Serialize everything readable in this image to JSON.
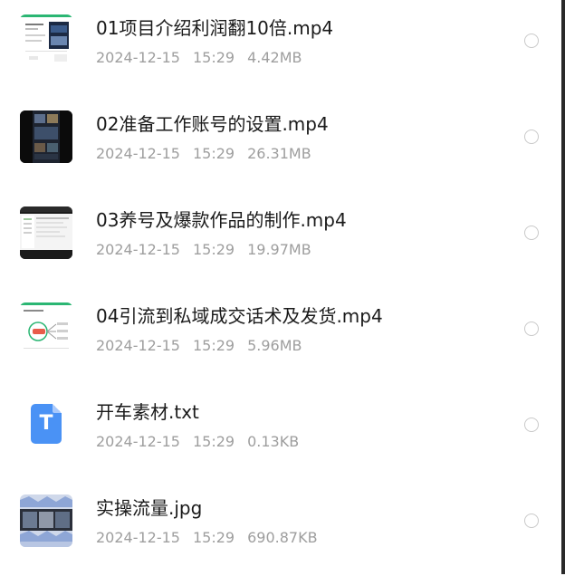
{
  "files": [
    {
      "name": "01项目介绍利润翻10倍.mp4",
      "date": "2024-12-15",
      "time": "15:29",
      "size": "4.42MB",
      "thumb_icon": "video-thumbnail-doc"
    },
    {
      "name": "02准备工作账号的设置.mp4",
      "date": "2024-12-15",
      "time": "15:29",
      "size": "26.31MB",
      "thumb_icon": "video-thumbnail-dark"
    },
    {
      "name": "03养号及爆款作品的制作.mp4",
      "date": "2024-12-15",
      "time": "15:29",
      "size": "19.97MB",
      "thumb_icon": "video-thumbnail-screen"
    },
    {
      "name": "04引流到私域成交话术及发货.mp4",
      "date": "2024-12-15",
      "time": "15:29",
      "size": "5.96MB",
      "thumb_icon": "video-thumbnail-mindmap"
    },
    {
      "name": "开车素材.txt",
      "date": "2024-12-15",
      "time": "15:29",
      "size": "0.13KB",
      "thumb_icon": "txt-file-icon",
      "icon_letter": "T"
    },
    {
      "name": "实操流量.jpg",
      "date": "2024-12-15",
      "time": "15:29",
      "size": "690.87KB",
      "thumb_icon": "image-thumbnail"
    }
  ],
  "colors": {
    "title": "#1a1a1a",
    "meta": "#9e9e9e",
    "radio_border": "#c9c9c9",
    "txt_icon": "#4a92f5",
    "accent_green": "#2bb673"
  }
}
